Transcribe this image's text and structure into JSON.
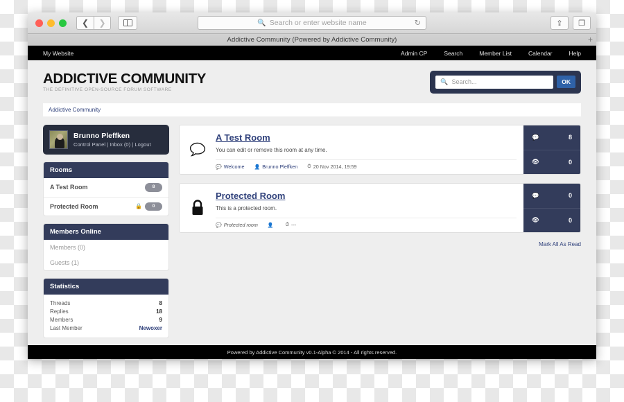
{
  "browser": {
    "url_placeholder": "Search or enter website name",
    "tab_title": "Addictive Community (Powered by Addictive Community)",
    "back_icon": "chevron-left-icon",
    "forward_icon": "chevron-right-icon",
    "sidebar_icon": "sidebar-toggle-icon",
    "reload_icon": "↻",
    "share_icon": "⇪",
    "tabs_icon": "❐",
    "newtab_label": "+"
  },
  "topnav": {
    "brand": "My Website",
    "links": [
      {
        "label": "Admin CP"
      },
      {
        "label": "Search"
      },
      {
        "label": "Member List"
      },
      {
        "label": "Calendar"
      },
      {
        "label": "Help"
      }
    ]
  },
  "header": {
    "logo_title": "ADDICTIVE COMMUNITY",
    "logo_subtitle": "THE DEFINITIVE OPEN-SOURCE FORUM SOFTWARE",
    "search_placeholder": "Search...",
    "search_value": "",
    "ok_label": "OK",
    "search_icon": "search-icon"
  },
  "breadcrumb": {
    "label": "Addictive Community"
  },
  "sidebar": {
    "user": {
      "name": "Brunno Pleffken",
      "links": "Control Panel | Inbox (0) | Logout"
    },
    "rooms_panel": {
      "title": "Rooms",
      "items": [
        {
          "label": "A Test Room",
          "count": "8",
          "locked": false
        },
        {
          "label": "Protected Room",
          "count": "0",
          "locked": true
        }
      ]
    },
    "members_panel": {
      "title": "Members Online",
      "items": [
        {
          "label": "Members (0)"
        },
        {
          "label": "Guests (1)"
        }
      ]
    },
    "statistics_panel": {
      "title": "Statistics",
      "rows": [
        {
          "label": "Threads",
          "value": "8",
          "link": false
        },
        {
          "label": "Replies",
          "value": "18",
          "link": false
        },
        {
          "label": "Members",
          "value": "9",
          "link": false
        },
        {
          "label": "Last Member",
          "value": "Newoxer",
          "link": true
        }
      ]
    }
  },
  "main": {
    "rooms": [
      {
        "icon": "speech-bubble-icon",
        "title": "A Test Room",
        "description": "You can edit or remove this room at any time.",
        "meta": {
          "thread": "Welcome",
          "author": "Brunno Pleffken",
          "date": "20 Nov 2014, 19:59"
        },
        "posts_count": "8",
        "views_count": "0"
      },
      {
        "icon": "lock-icon",
        "title": "Protected Room",
        "description": "This is a protected room.",
        "meta": {
          "thread": "Protected room",
          "author": "",
          "date": "---"
        },
        "posts_count": "0",
        "views_count": "0"
      }
    ],
    "mark_all_read": "Mark All As Read"
  },
  "footer": {
    "text": "Powered by Addictive Community v0.1-Alpha © 2014 - All rights reserved."
  },
  "colors": {
    "navy_header": "#333c5b",
    "dark_user": "#272d3d",
    "link": "#31427c",
    "ok_button": "#2f62a8",
    "search_wrap": "#2c3550"
  }
}
